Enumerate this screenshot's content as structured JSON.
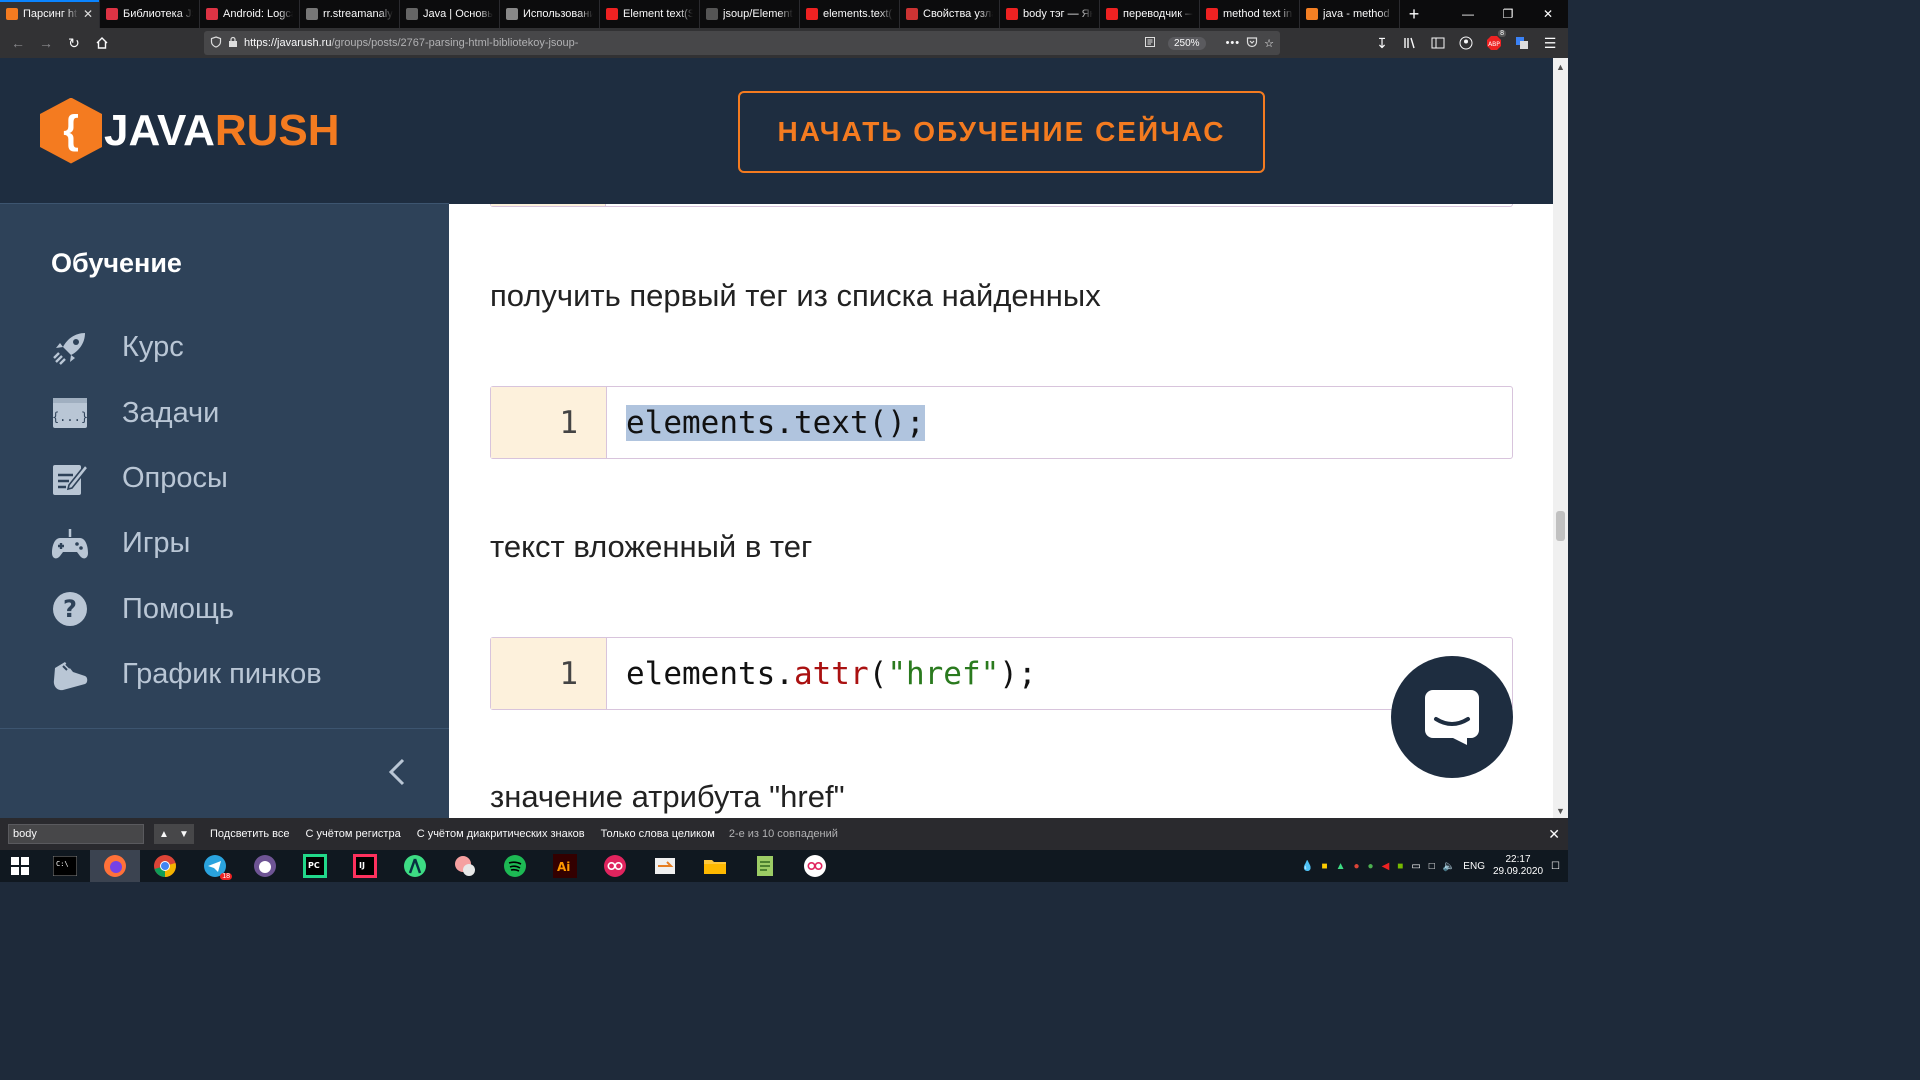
{
  "browser": {
    "tabs": [
      {
        "title": "Парсинг html",
        "active": true,
        "fav_color": "#f47b20"
      },
      {
        "title": "Библиотека JSoup",
        "fav_color": "#d34"
      },
      {
        "title": "Android: Logcat",
        "fav_color": "#d34"
      },
      {
        "title": "rr.streamanalyst.com",
        "fav_color": "#777"
      },
      {
        "title": "Java | Основы",
        "fav_color": "#666"
      },
      {
        "title": "Использование",
        "fav_color": "#888"
      },
      {
        "title": "Element text(String)",
        "fav_color": "#e22"
      },
      {
        "title": "jsoup/Element.java",
        "fav_color": "#555"
      },
      {
        "title": "elements.text()",
        "fav_color": "#e22"
      },
      {
        "title": "Свойства узла",
        "fav_color": "#c33"
      },
      {
        "title": "body тэг — Яндекс",
        "fav_color": "#e22"
      },
      {
        "title": "переводчик — Яндекс",
        "fav_color": "#e22"
      },
      {
        "title": "method text in jsoup",
        "fav_color": "#e22"
      },
      {
        "title": "java - method",
        "fav_color": "#f48024"
      }
    ],
    "new_tab": "+",
    "url_host": "https://javarush.ru",
    "url_path": "/groups/posts/2767-parsing-html-bibliotekoy-jsoup-",
    "zoom": "250%",
    "adblock_badge": "8"
  },
  "site": {
    "logo_java": "JAVA",
    "logo_rush": "RUSH",
    "logo_brace": "{",
    "cta": "НАЧАТЬ ОБУЧЕНИЕ СЕЙЧАС",
    "sidebar_heading": "Обучение",
    "sidebar_items": [
      "Курс",
      "Задачи",
      "Опросы",
      "Игры",
      "Помощь",
      "График пинков"
    ]
  },
  "article": {
    "p1": "получить первый тег из списка найденных",
    "code1_line": "1",
    "code1": "elements.text();",
    "p2": "текст вложенный в тег",
    "code2_line": "1",
    "code2_obj": "elements.",
    "code2_method": "attr",
    "code2_open": "(",
    "code2_str": "\"href\"",
    "code2_close": ");",
    "p3": "значение атрибута \"href\""
  },
  "findbar": {
    "query": "body",
    "highlight_all": "Подсветить все",
    "match_case": "С учётом регистра",
    "diacritics": "С учётом диакритических знаков",
    "whole_words": "Только слова целиком",
    "status": "2-е из 10 совпадений"
  },
  "taskbar": {
    "lang": "ENG",
    "time": "22:17",
    "date": "29.09.2020",
    "telegram_badge": "18"
  },
  "colors": {
    "accent": "#f47b20",
    "sidebar_bg": "#2e4259",
    "header_bg": "#1e2d40",
    "code_gutter": "#fdf1dc"
  }
}
